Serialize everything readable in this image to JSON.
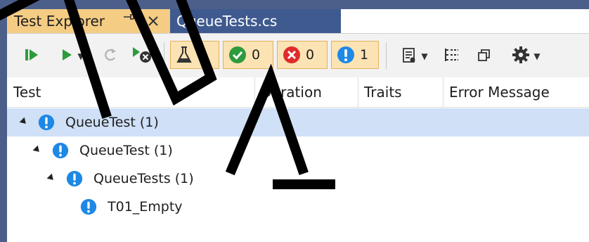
{
  "tabs": {
    "test_explorer": "Test Explorer",
    "pin_glyph": "⊕",
    "close_glyph": "✕",
    "file_tab": "QueueTests.cs"
  },
  "toolbar": {
    "counters": {
      "total": "1",
      "passed": "0",
      "failed": "0",
      "not_run": "1"
    }
  },
  "columns": [
    "Test",
    "Duration",
    "Traits",
    "Error Message"
  ],
  "tree": [
    {
      "label": "QueueTest (1)",
      "level": 0,
      "selected": true
    },
    {
      "label": "QueueTest (1)",
      "level": 1,
      "selected": false
    },
    {
      "label": "QueueTests (1)",
      "level": 2,
      "selected": false
    },
    {
      "label": "T01_Empty",
      "level": 3,
      "selected": false
    }
  ],
  "colors": {
    "active_tab": "#f5cc84",
    "file_tab": "#3f5a8f",
    "info_blue": "#1e88e5",
    "pass_green": "#2e9b3d",
    "fail_red": "#e02b2b",
    "selection": "#cfe0f7"
  }
}
